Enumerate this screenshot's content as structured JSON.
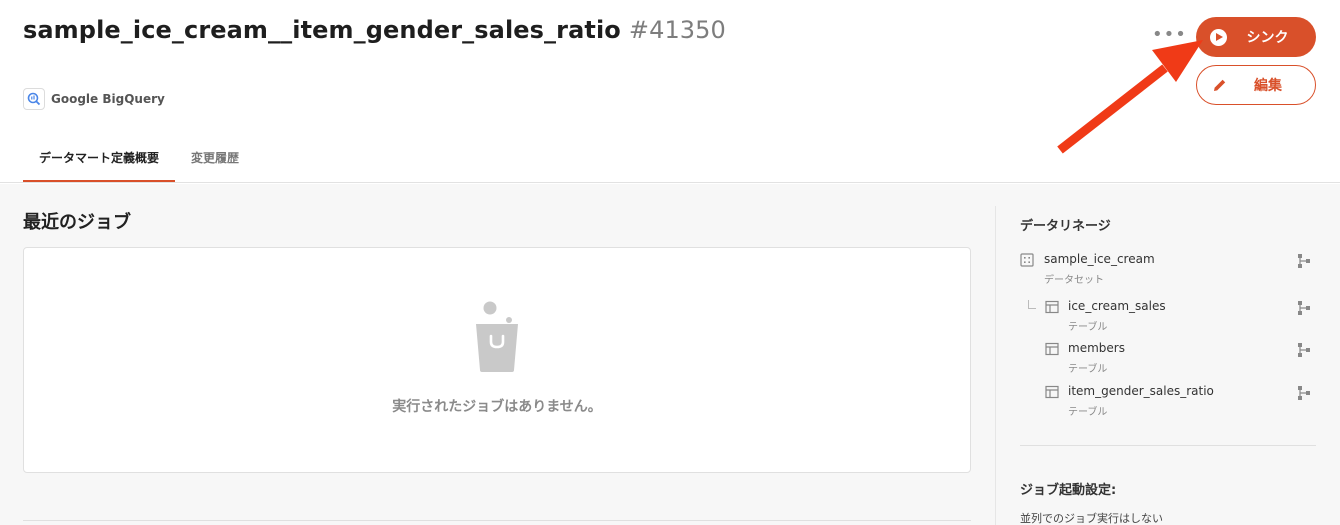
{
  "header": {
    "title": "sample_ice_cream__item_gender_sales_ratio",
    "id": "#41350",
    "more_label": "•••",
    "sync_label": "シンク",
    "edit_label": "編集",
    "source_label": "Google BigQuery"
  },
  "tabs": [
    {
      "label": "データマート定義概要",
      "active": true
    },
    {
      "label": "変更履歴",
      "active": false
    }
  ],
  "jobs": {
    "title": "最近のジョブ",
    "empty_text": "実行されたジョブはありません。"
  },
  "lineage": {
    "title": "データリネージ",
    "items": [
      {
        "name": "sample_ice_cream",
        "type": "データセット"
      },
      {
        "name": "ice_cream_sales",
        "type": "テーブル"
      },
      {
        "name": "members",
        "type": "テーブル"
      },
      {
        "name": "item_gender_sales_ratio",
        "type": "テーブル"
      }
    ]
  },
  "job_settings": {
    "title": "ジョブ起動設定:",
    "value": "並列でのジョブ実行はしない"
  },
  "colors": {
    "accent": "#d9502a",
    "annotation_arrow": "#f03a17"
  }
}
